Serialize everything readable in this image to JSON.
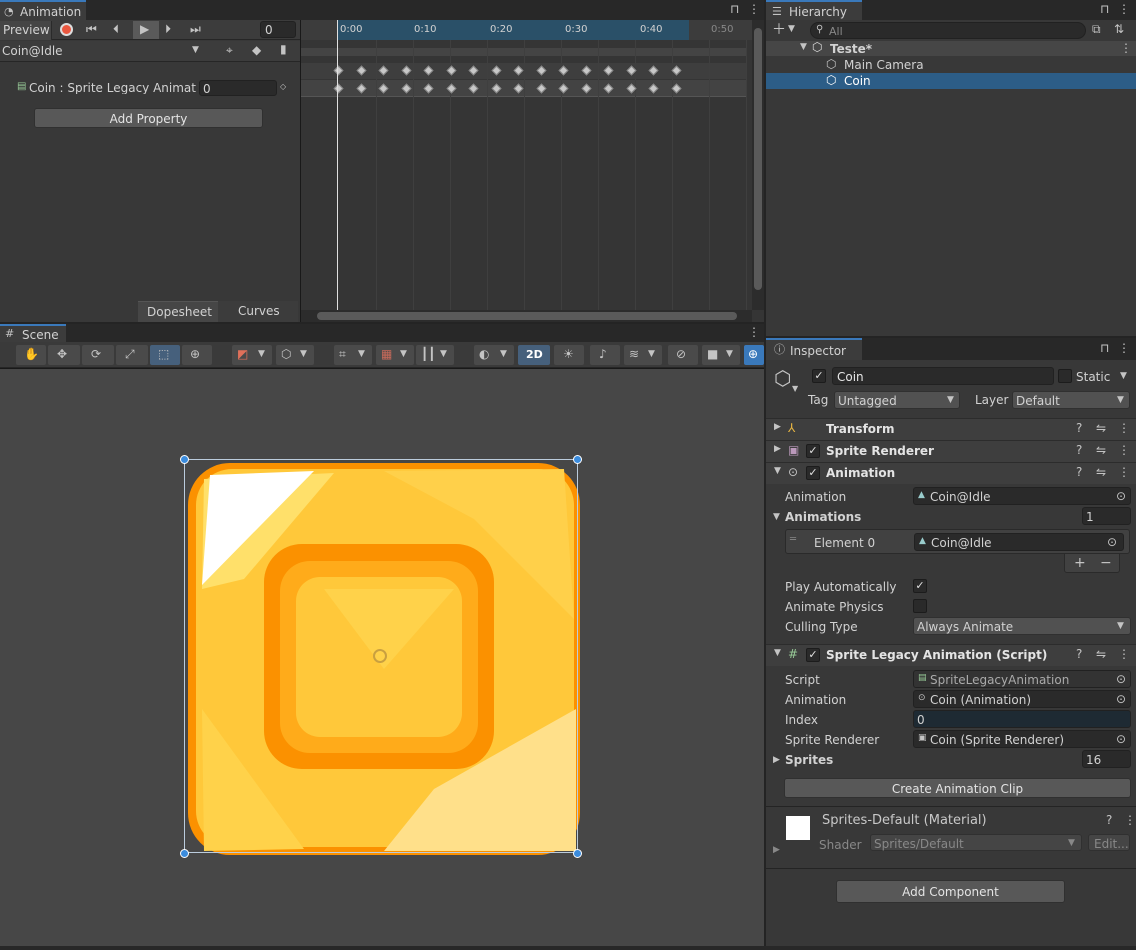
{
  "colors": {
    "accent": "#3a79bb",
    "selection": "#2c5d87",
    "coin_orange": "#fb9100",
    "coin_yellow": "#ffd24a"
  },
  "animation": {
    "tab_title": "Animation",
    "preview_label": "Preview",
    "frame_value": "0",
    "clip_name": "Coin@Idle",
    "property_label": "Coin : Sprite Legacy Animatior",
    "property_value": "0",
    "add_property_label": "Add Property",
    "dopesheet_label": "Dopesheet",
    "curves_label": "Curves",
    "ruler": [
      "0:00",
      "0:10",
      "0:20",
      "0:30",
      "0:40",
      "0:50"
    ]
  },
  "hierarchy": {
    "tab_title": "Hierarchy",
    "search_placeholder": "All",
    "scene_name": "Teste*",
    "items": [
      "Main Camera",
      "Coin"
    ]
  },
  "scene": {
    "tab_title": "Scene",
    "mode_2d": "2D"
  },
  "inspector": {
    "tab_title": "Inspector",
    "object_name": "Coin",
    "static_label": "Static",
    "tag_label": "Tag",
    "tag_value": "Untagged",
    "layer_label": "Layer",
    "layer_value": "Default",
    "components": {
      "transform": "Transform",
      "sprite_renderer": "Sprite Renderer",
      "animation": "Animation",
      "script": "Sprite Legacy Animation (Script)"
    },
    "animation_fields": {
      "animation_label": "Animation",
      "animation_value": "Coin@Idle",
      "animations_label": "Animations",
      "animations_count": "1",
      "element_label": "Element 0",
      "element_value": "Coin@Idle",
      "play_auto_label": "Play Automatically",
      "play_auto_checked": true,
      "animate_physics_label": "Animate Physics",
      "animate_physics_checked": false,
      "culling_label": "Culling Type",
      "culling_value": "Always Animate"
    },
    "script_fields": {
      "script_label": "Script",
      "script_value": "SpriteLegacyAnimation",
      "animation_label": "Animation",
      "animation_value": "Coin (Animation)",
      "index_label": "Index",
      "index_value": "0",
      "renderer_label": "Sprite Renderer",
      "renderer_value": "Coin (Sprite Renderer)",
      "sprites_label": "Sprites",
      "sprites_count": "16",
      "create_clip_label": "Create Animation Clip"
    },
    "material": {
      "name": "Sprites-Default (Material)",
      "shader_label": "Shader",
      "shader_value": "Sprites/Default",
      "edit_label": "Edit..."
    },
    "add_component_label": "Add Component"
  }
}
